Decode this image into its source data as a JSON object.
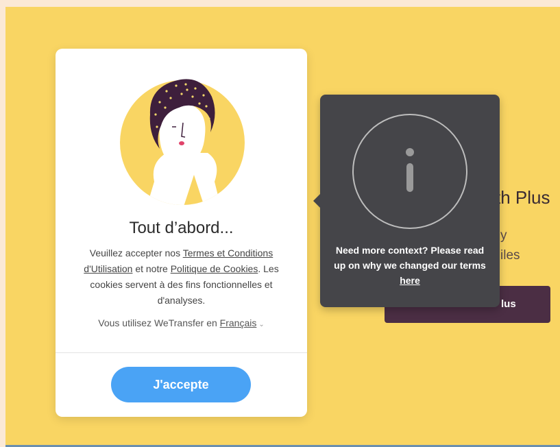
{
  "promo": {
    "title_fragment": "th Plus",
    "line1_fragment": "y",
    "line2_fragment": "iles",
    "button_fragment": "lus"
  },
  "terms_card": {
    "title": "Tout d’abord...",
    "text_before_terms": "Veuillez accepter nos ",
    "terms_link": "Termes et Conditions d'Utilisation",
    "text_between": " et notre ",
    "cookie_policy_link": "Politique de Cookies",
    "text_after": ". Les cookies servent à des fins fonctionnelles et d'analyses.",
    "language_prefix": "Vous utilisez WeTransfer en ",
    "language_value": "Français",
    "accept_button": "J'accepte"
  },
  "info_tooltip": {
    "text": "Need more context? Please read up on why we changed our terms ",
    "link": "here"
  },
  "colors": {
    "page_background": "#f9d563",
    "accept_button": "#4aa3f5",
    "tooltip_background": "#454549",
    "promo_button": "#4b2e44"
  },
  "icons": {
    "avatar": "woman-illustration-avatar",
    "info": "info-icon",
    "language_dropdown": "chevron-down-icon"
  }
}
